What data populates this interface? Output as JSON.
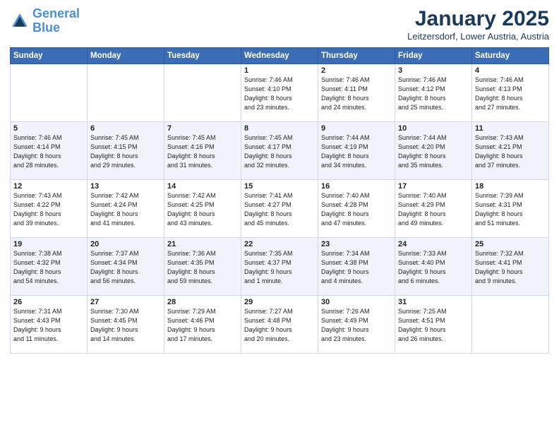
{
  "logo": {
    "line1": "General",
    "line2": "Blue"
  },
  "title": "January 2025",
  "subtitle": "Leitzersdorf, Lower Austria, Austria",
  "weekdays": [
    "Sunday",
    "Monday",
    "Tuesday",
    "Wednesday",
    "Thursday",
    "Friday",
    "Saturday"
  ],
  "weeks": [
    [
      {
        "day": "",
        "info": ""
      },
      {
        "day": "",
        "info": ""
      },
      {
        "day": "",
        "info": ""
      },
      {
        "day": "1",
        "info": "Sunrise: 7:46 AM\nSunset: 4:10 PM\nDaylight: 8 hours\nand 23 minutes."
      },
      {
        "day": "2",
        "info": "Sunrise: 7:46 AM\nSunset: 4:11 PM\nDaylight: 8 hours\nand 24 minutes."
      },
      {
        "day": "3",
        "info": "Sunrise: 7:46 AM\nSunset: 4:12 PM\nDaylight: 8 hours\nand 25 minutes."
      },
      {
        "day": "4",
        "info": "Sunrise: 7:46 AM\nSunset: 4:13 PM\nDaylight: 8 hours\nand 27 minutes."
      }
    ],
    [
      {
        "day": "5",
        "info": "Sunrise: 7:46 AM\nSunset: 4:14 PM\nDaylight: 8 hours\nand 28 minutes."
      },
      {
        "day": "6",
        "info": "Sunrise: 7:45 AM\nSunset: 4:15 PM\nDaylight: 8 hours\nand 29 minutes."
      },
      {
        "day": "7",
        "info": "Sunrise: 7:45 AM\nSunset: 4:16 PM\nDaylight: 8 hours\nand 31 minutes."
      },
      {
        "day": "8",
        "info": "Sunrise: 7:45 AM\nSunset: 4:17 PM\nDaylight: 8 hours\nand 32 minutes."
      },
      {
        "day": "9",
        "info": "Sunrise: 7:44 AM\nSunset: 4:19 PM\nDaylight: 8 hours\nand 34 minutes."
      },
      {
        "day": "10",
        "info": "Sunrise: 7:44 AM\nSunset: 4:20 PM\nDaylight: 8 hours\nand 35 minutes."
      },
      {
        "day": "11",
        "info": "Sunrise: 7:43 AM\nSunset: 4:21 PM\nDaylight: 8 hours\nand 37 minutes."
      }
    ],
    [
      {
        "day": "12",
        "info": "Sunrise: 7:43 AM\nSunset: 4:22 PM\nDaylight: 8 hours\nand 39 minutes."
      },
      {
        "day": "13",
        "info": "Sunrise: 7:42 AM\nSunset: 4:24 PM\nDaylight: 8 hours\nand 41 minutes."
      },
      {
        "day": "14",
        "info": "Sunrise: 7:42 AM\nSunset: 4:25 PM\nDaylight: 8 hours\nand 43 minutes."
      },
      {
        "day": "15",
        "info": "Sunrise: 7:41 AM\nSunset: 4:27 PM\nDaylight: 8 hours\nand 45 minutes."
      },
      {
        "day": "16",
        "info": "Sunrise: 7:40 AM\nSunset: 4:28 PM\nDaylight: 8 hours\nand 47 minutes."
      },
      {
        "day": "17",
        "info": "Sunrise: 7:40 AM\nSunset: 4:29 PM\nDaylight: 8 hours\nand 49 minutes."
      },
      {
        "day": "18",
        "info": "Sunrise: 7:39 AM\nSunset: 4:31 PM\nDaylight: 8 hours\nand 51 minutes."
      }
    ],
    [
      {
        "day": "19",
        "info": "Sunrise: 7:38 AM\nSunset: 4:32 PM\nDaylight: 8 hours\nand 54 minutes."
      },
      {
        "day": "20",
        "info": "Sunrise: 7:37 AM\nSunset: 4:34 PM\nDaylight: 8 hours\nand 56 minutes."
      },
      {
        "day": "21",
        "info": "Sunrise: 7:36 AM\nSunset: 4:35 PM\nDaylight: 8 hours\nand 59 minutes."
      },
      {
        "day": "22",
        "info": "Sunrise: 7:35 AM\nSunset: 4:37 PM\nDaylight: 9 hours\nand 1 minute."
      },
      {
        "day": "23",
        "info": "Sunrise: 7:34 AM\nSunset: 4:38 PM\nDaylight: 9 hours\nand 4 minutes."
      },
      {
        "day": "24",
        "info": "Sunrise: 7:33 AM\nSunset: 4:40 PM\nDaylight: 9 hours\nand 6 minutes."
      },
      {
        "day": "25",
        "info": "Sunrise: 7:32 AM\nSunset: 4:41 PM\nDaylight: 9 hours\nand 9 minutes."
      }
    ],
    [
      {
        "day": "26",
        "info": "Sunrise: 7:31 AM\nSunset: 4:43 PM\nDaylight: 9 hours\nand 11 minutes."
      },
      {
        "day": "27",
        "info": "Sunrise: 7:30 AM\nSunset: 4:45 PM\nDaylight: 9 hours\nand 14 minutes."
      },
      {
        "day": "28",
        "info": "Sunrise: 7:29 AM\nSunset: 4:46 PM\nDaylight: 9 hours\nand 17 minutes."
      },
      {
        "day": "29",
        "info": "Sunrise: 7:27 AM\nSunset: 4:48 PM\nDaylight: 9 hours\nand 20 minutes."
      },
      {
        "day": "30",
        "info": "Sunrise: 7:26 AM\nSunset: 4:49 PM\nDaylight: 9 hours\nand 23 minutes."
      },
      {
        "day": "31",
        "info": "Sunrise: 7:25 AM\nSunset: 4:51 PM\nDaylight: 9 hours\nand 26 minutes."
      },
      {
        "day": "",
        "info": ""
      }
    ]
  ]
}
